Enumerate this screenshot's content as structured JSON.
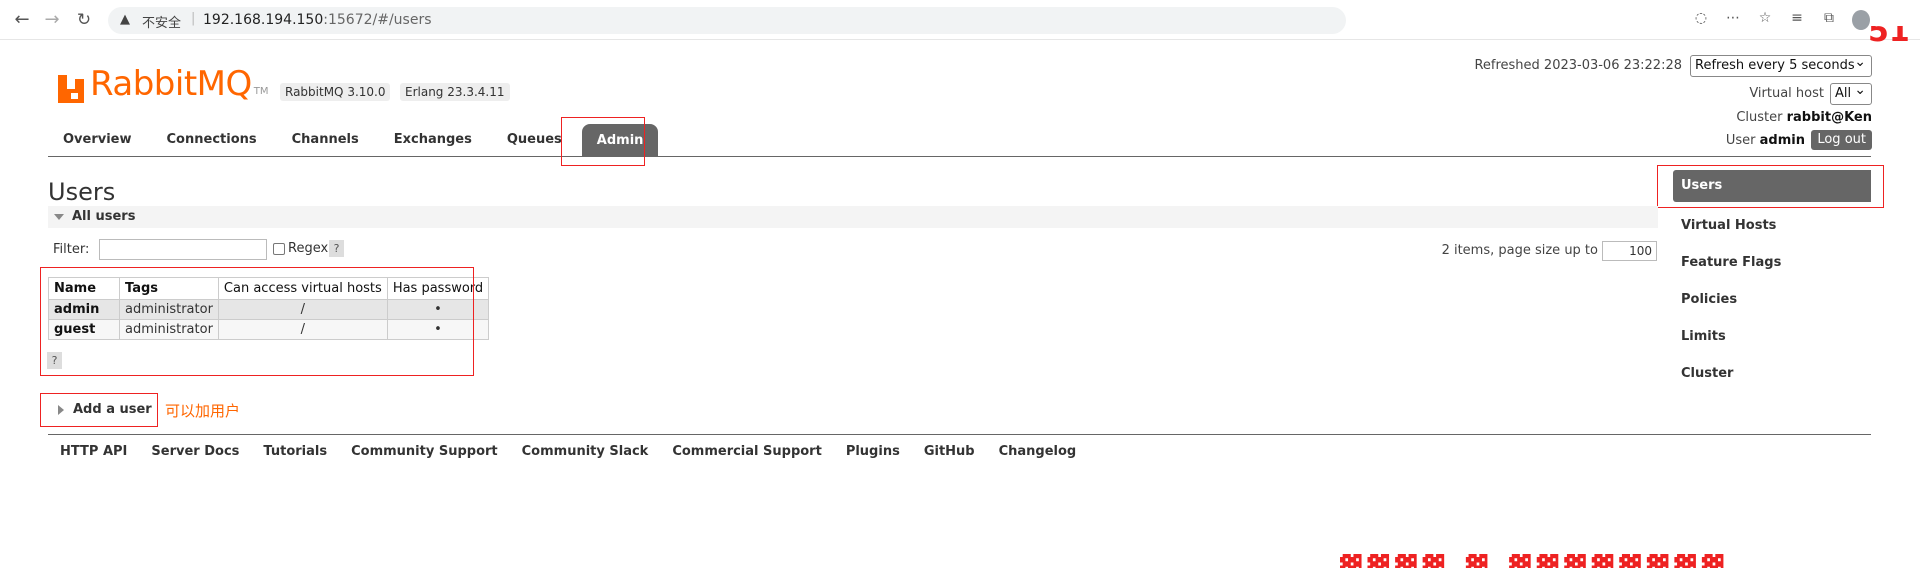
{
  "browser": {
    "security_label": "不安全",
    "url_host": "192.168.194.150",
    "url_rest": ":15672/#/users"
  },
  "header": {
    "logo_text": "RabbitMQ",
    "logo_tm": "TM",
    "rabbit_version": "RabbitMQ 3.10.0",
    "erlang_version": "Erlang 23.3.4.11",
    "refreshed": "Refreshed 2023-03-06 23:22:28",
    "refresh_option": "Refresh every 5 seconds",
    "vhost_label": "Virtual host",
    "vhost_value": "All",
    "cluster_label": "Cluster",
    "cluster_name": "rabbit@Ken",
    "user_label": "User",
    "user_name": "admin",
    "logout_label": "Log out"
  },
  "tabs": [
    "Overview",
    "Connections",
    "Channels",
    "Exchanges",
    "Queues",
    "Admin"
  ],
  "sidebar": [
    "Users",
    "Virtual Hosts",
    "Feature Flags",
    "Policies",
    "Limits",
    "Cluster"
  ],
  "page": {
    "title": "Users",
    "section": "All users",
    "filter_label": "Filter:",
    "regex_label": "Regex",
    "help": "?",
    "items_label": "2 items, page size up to",
    "page_size": "100"
  },
  "table": {
    "headers": [
      "Name",
      "Tags",
      "Can access virtual hosts",
      "Has password"
    ],
    "rows": [
      {
        "name": "admin",
        "tags": "administrator",
        "vhosts": "/",
        "password": "•"
      },
      {
        "name": "guest",
        "tags": "administrator",
        "vhosts": "/",
        "password": "•"
      }
    ]
  },
  "add_user": {
    "label": "Add a user",
    "note": "可以加用户"
  },
  "footer": [
    "HTTP API",
    "Server Docs",
    "Tutorials",
    "Community Support",
    "Community Slack",
    "Commercial Support",
    "Plugins",
    "GitHub",
    "Changelog"
  ],
  "colors": {
    "brand": "#ff6600",
    "annotation": "#e22222",
    "active_tab": "#666666"
  }
}
